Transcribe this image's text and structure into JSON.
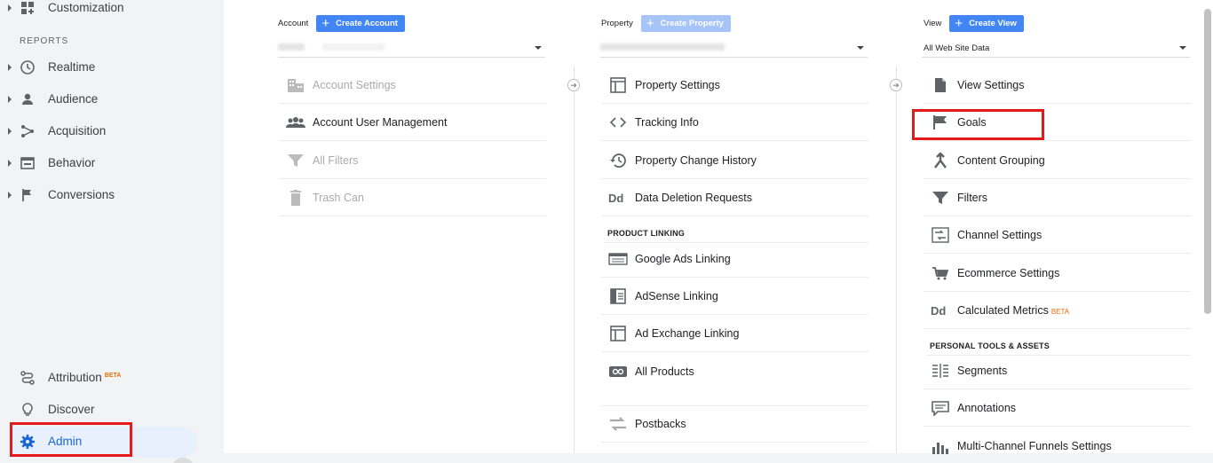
{
  "sidebar": {
    "customization": "Customization",
    "reports_heading": "REPORTS",
    "items": [
      {
        "label": "Realtime",
        "icon": "clock-icon"
      },
      {
        "label": "Audience",
        "icon": "person-icon"
      },
      {
        "label": "Acquisition",
        "icon": "acquisition-icon"
      },
      {
        "label": "Behavior",
        "icon": "behavior-icon"
      },
      {
        "label": "Conversions",
        "icon": "flag-icon"
      }
    ],
    "attribution": "Attribution",
    "attribution_badge": "BETA",
    "discover": "Discover",
    "admin": "Admin"
  },
  "account": {
    "label": "Account",
    "create": "Create Account",
    "items": [
      {
        "label": "Account Settings",
        "icon": "building-icon",
        "disabled": true
      },
      {
        "label": "Account User Management",
        "icon": "users-icon",
        "disabled": false
      },
      {
        "label": "All Filters",
        "icon": "filter-icon",
        "disabled": true
      },
      {
        "label": "Trash Can",
        "icon": "trash-icon",
        "disabled": true
      }
    ]
  },
  "property": {
    "label": "Property",
    "create": "Create Property",
    "items": [
      {
        "label": "Property Settings",
        "icon": "window-icon"
      },
      {
        "label": "Tracking Info",
        "icon": "code-icon"
      },
      {
        "label": "Property Change History",
        "icon": "history-icon"
      },
      {
        "label": "Data Deletion Requests",
        "icon": "dd-icon"
      }
    ],
    "product_linking_heading": "PRODUCT LINKING",
    "linking": [
      {
        "label": "Google Ads Linking",
        "icon": "ads-icon"
      },
      {
        "label": "AdSense Linking",
        "icon": "adsense-icon"
      },
      {
        "label": "Ad Exchange Linking",
        "icon": "window-icon"
      },
      {
        "label": "All Products",
        "icon": "link-icon"
      },
      {
        "label": "Postbacks",
        "icon": "postbacks-icon"
      }
    ]
  },
  "view": {
    "label": "View",
    "create": "Create View",
    "selected": "All Web Site Data",
    "items": [
      {
        "label": "View Settings",
        "icon": "document-icon"
      },
      {
        "label": "Goals",
        "icon": "flag-icon"
      },
      {
        "label": "Content Grouping",
        "icon": "grouping-icon"
      },
      {
        "label": "Filters",
        "icon": "filter-icon"
      },
      {
        "label": "Channel Settings",
        "icon": "channel-icon"
      },
      {
        "label": "Ecommerce Settings",
        "icon": "cart-icon"
      },
      {
        "label": "Calculated Metrics",
        "icon": "dd-icon",
        "badge": "BETA"
      }
    ],
    "personal_heading": "PERSONAL TOOLS & ASSETS",
    "personal": [
      {
        "label": "Segments",
        "icon": "segments-icon"
      },
      {
        "label": "Annotations",
        "icon": "comment-icon"
      },
      {
        "label": "Multi-Channel Funnels Settings",
        "icon": "bars-icon"
      }
    ]
  }
}
